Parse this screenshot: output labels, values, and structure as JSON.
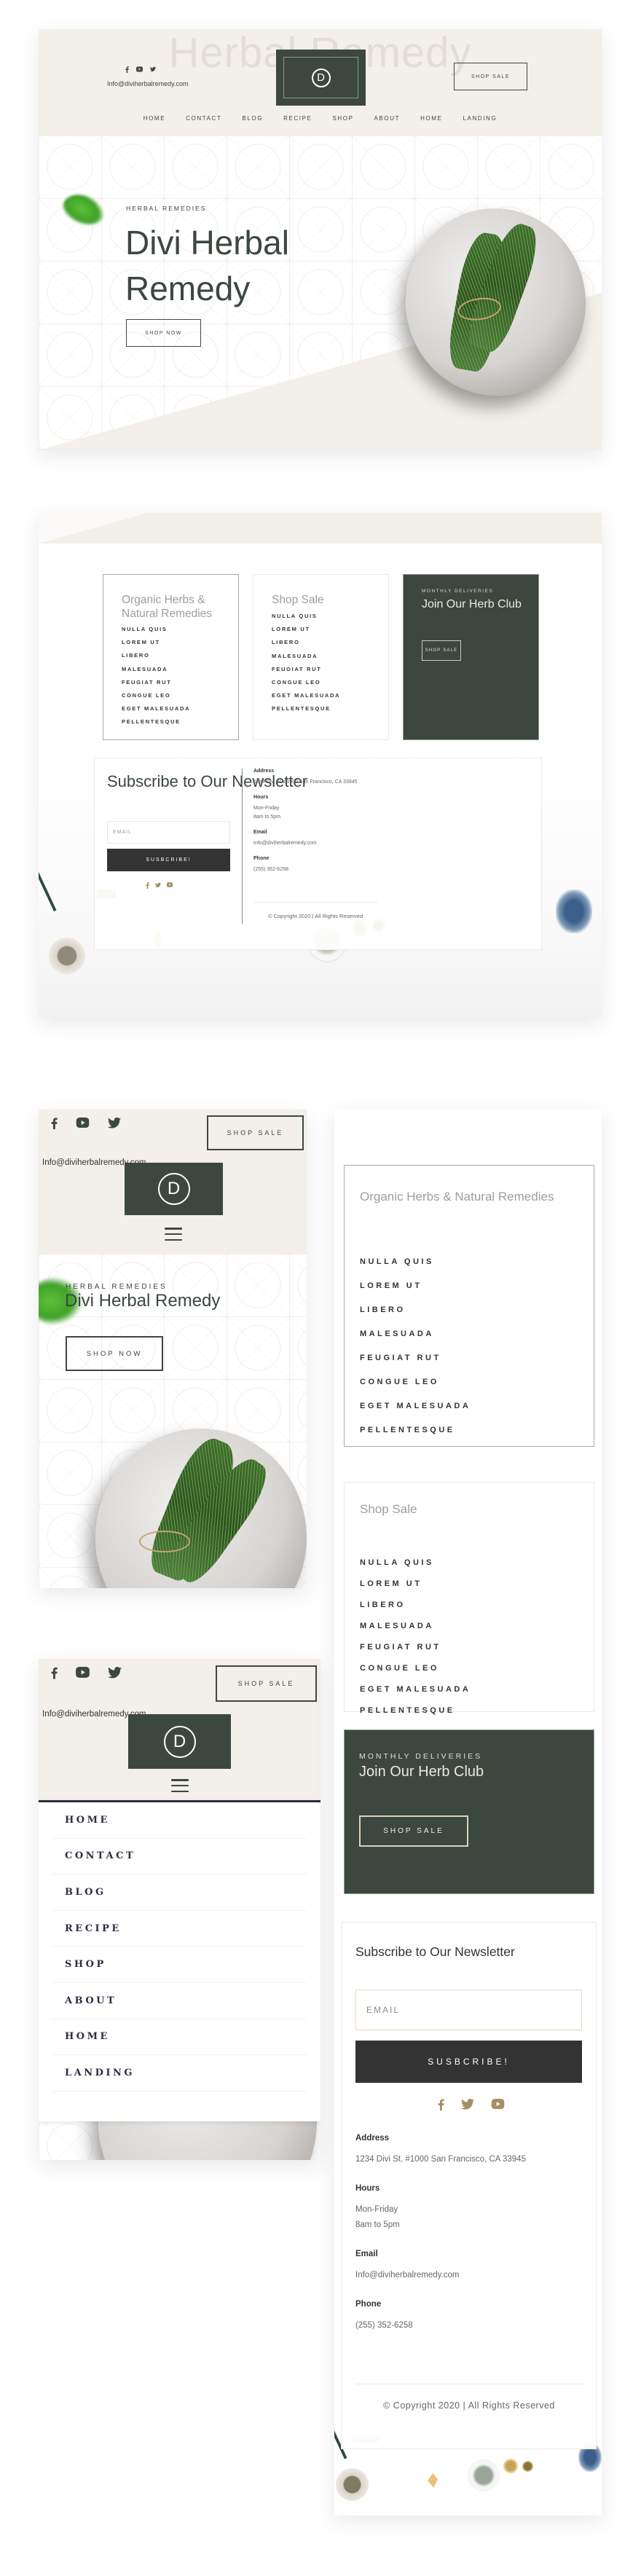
{
  "brand": {
    "site_name": "Herbal Remedy",
    "logo_letter": "D",
    "colors": {
      "primary": "#3c4740",
      "beige": "#f3efe9",
      "gold": "#a58e63",
      "dark_button": "#333333",
      "menu_accent": "#2e2c42"
    }
  },
  "header": {
    "socials": [
      "facebook-icon",
      "youtube-icon",
      "twitter-icon"
    ],
    "email": "Info@diviherbalremedy.com",
    "shop_sale": "SHOP SALE",
    "nav": [
      "HOME",
      "CONTACT",
      "BLOG",
      "RECIPE",
      "SHOP",
      "ABOUT",
      "HOME",
      "LANDING"
    ]
  },
  "hero": {
    "eyebrow": "HERBAL REMEDIES",
    "title_line1": "Divi Herbal",
    "title_line2": "Remedy",
    "title_full": "Divi Herbal Remedy",
    "cta": "SHOP NOW"
  },
  "cards": {
    "organic": {
      "title": "Organic Herbs & Natural Remedies",
      "items": [
        "NULLA QUIS",
        "LOREM UT",
        "LIBERO",
        "MALESUADA",
        "FEUGIAT RUT",
        "CONGUE LEO",
        "EGET MALESUADA",
        "PELLENTESQUE"
      ]
    },
    "shop_sale": {
      "title": "Shop Sale",
      "items": [
        "NULLA QUIS",
        "LOREM UT",
        "LIBERO",
        "MALESUADA",
        "FEUGIAT RUT",
        "CONGUE LEO",
        "EGET MALESUADA",
        "PELLENTESQUE"
      ]
    },
    "herb_club": {
      "eyebrow": "MONTHLY DELIVERIES",
      "title": "Join Our Herb Club",
      "button": "SHOP SALE"
    }
  },
  "newsletter": {
    "title": "Subscribe to Our Newsletter",
    "email_placeholder": "EMAIL",
    "button": "SUSBCRIBE!",
    "socials": [
      "facebook-icon",
      "twitter-icon",
      "youtube-icon"
    ]
  },
  "contact": {
    "address_label": "Address",
    "address": "1234 Divi St. #1000 San Francisco, CA 33945",
    "hours_label": "Hours",
    "hours_days": "Mon-Friday",
    "hours_time": "8am to 5pm",
    "email_label": "Email",
    "email": "Info@diviherbalremedy.com",
    "phone_label": "Phone",
    "phone": "(255) 352-6258"
  },
  "footer": {
    "copyright": "© Copyright 2020 | All Rights Reserved"
  }
}
